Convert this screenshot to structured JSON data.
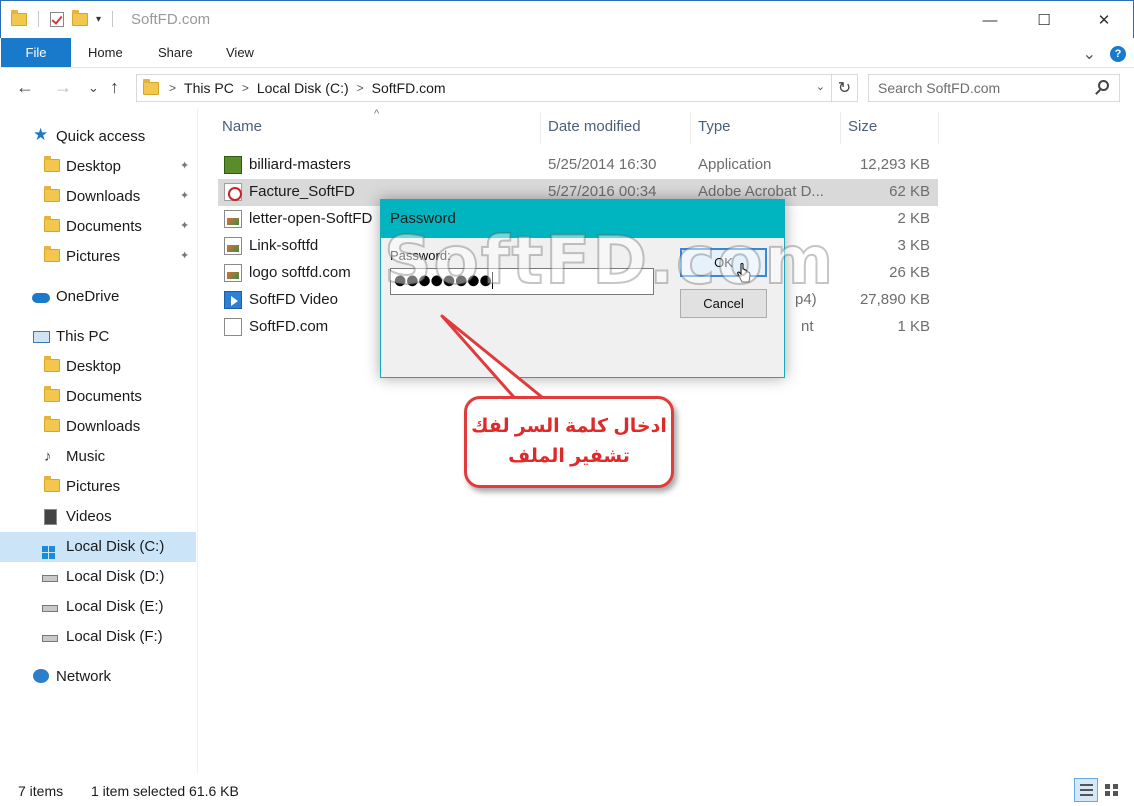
{
  "window": {
    "title": "SoftFD.com",
    "minimize": "—",
    "maximize": "☐",
    "close": "✕"
  },
  "ribbon": {
    "file": "File",
    "tabs": [
      "Home",
      "Share",
      "View"
    ],
    "expand": "⌄",
    "help": "?"
  },
  "nav": {
    "back": "←",
    "forward": "→",
    "recent": "⌄",
    "up": "↑",
    "breadcrumb": [
      "This PC",
      "Local Disk (C:)",
      "SoftFD.com"
    ],
    "crumb_sep": ">",
    "dropdown": "⌄",
    "refresh": "↻",
    "search_placeholder": "Search SoftFD.com"
  },
  "sidebar": {
    "items": [
      {
        "label": "Quick access",
        "icon": "star-icon"
      },
      {
        "label": "Desktop",
        "icon": "desktop-folder-icon",
        "pinned": true
      },
      {
        "label": "Downloads",
        "icon": "downloads-folder-icon",
        "pinned": true
      },
      {
        "label": "Documents",
        "icon": "documents-folder-icon",
        "pinned": true
      },
      {
        "label": "Pictures",
        "icon": "pictures-folder-icon",
        "pinned": true
      },
      {
        "label": "OneDrive",
        "icon": "cloud-icon"
      },
      {
        "label": "This PC",
        "icon": "computer-icon"
      },
      {
        "label": "Desktop",
        "icon": "desktop-folder-icon"
      },
      {
        "label": "Documents",
        "icon": "documents-folder-icon"
      },
      {
        "label": "Downloads",
        "icon": "downloads-folder-icon"
      },
      {
        "label": "Music",
        "icon": "music-folder-icon"
      },
      {
        "label": "Pictures",
        "icon": "pictures-folder-icon"
      },
      {
        "label": "Videos",
        "icon": "videos-folder-icon"
      },
      {
        "label": "Local Disk (C:)",
        "icon": "windows-drive-icon",
        "selected": true
      },
      {
        "label": "Local Disk (D:)",
        "icon": "drive-icon"
      },
      {
        "label": "Local Disk (E:)",
        "icon": "drive-icon"
      },
      {
        "label": "Local Disk (F:)",
        "icon": "drive-icon"
      },
      {
        "label": "Network",
        "icon": "network-icon"
      }
    ],
    "pin_glyph": "📌"
  },
  "filelist": {
    "columns": [
      "Name",
      "Date modified",
      "Type",
      "Size"
    ],
    "sort_glyph": "^",
    "rows": [
      {
        "name": "billiard-masters",
        "date": "5/25/2014 16:30",
        "type": "Application",
        "size": "12,293 KB",
        "icon": "application-icon"
      },
      {
        "name": "Facture_SoftFD",
        "date": "5/27/2016 00:34",
        "type": "Adobe Acrobat D...",
        "size": "62 KB",
        "icon": "pdf-icon",
        "selected": true
      },
      {
        "name": "letter-open-SoftFD",
        "date": "",
        "type": "",
        "size": "2 KB",
        "icon": "image-file-icon"
      },
      {
        "name": "Link-softfd",
        "date": "",
        "type": "",
        "size": "3 KB",
        "icon": "image-file-icon"
      },
      {
        "name": "logo softfd.com",
        "date": "",
        "type": "",
        "size": "26 KB",
        "icon": "image-file-icon"
      },
      {
        "name": "SoftFD Video",
        "date": "",
        "type": "p4)",
        "size": "27,890 KB",
        "icon": "video-file-icon"
      },
      {
        "name": "SoftFD.com",
        "date": "",
        "type": "nt",
        "size": "1 KB",
        "icon": "text-file-icon"
      }
    ]
  },
  "status": {
    "count": "7 items",
    "selection": "1 item selected  61.6 KB"
  },
  "dialog": {
    "title": "Password",
    "label": "Password:",
    "value": "●●●●●●●●",
    "ok": "OK",
    "cancel": "Cancel"
  },
  "watermark": "SoftFD.com",
  "callout": {
    "line1": "ادخال كلمة السر لفك",
    "line2": "تشفير الملف",
    "border_color": "#e23b3b",
    "text_color": "#e02a2a"
  },
  "colors": {
    "accent": "#1979ca",
    "dialog_title": "#00b5c0",
    "selection": "#cce4f7"
  }
}
